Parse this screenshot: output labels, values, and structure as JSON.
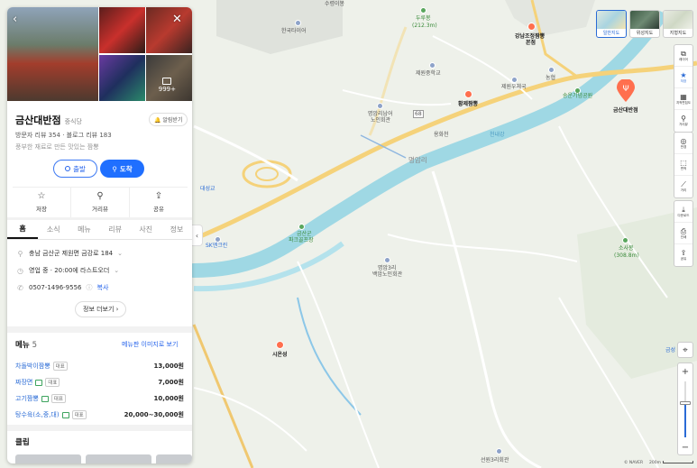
{
  "colors": {
    "accent": "#1f6fff",
    "link": "#2563eb",
    "pin": "#ff6f4e",
    "river": "#9fd8e4",
    "road_main": "#f5d27a"
  },
  "panel": {
    "photos": {
      "back_icon": "back-arrow-icon",
      "close_icon": "close-icon",
      "count": "999+"
    },
    "place": {
      "name": "금산대반점",
      "category": "중식당",
      "claim_label": "알림받기",
      "reviews": "방문자 리뷰 354 · 블로그 리뷰 183",
      "description": "풍부한 재료로 만든 맛있는 짬뽕"
    },
    "directions": {
      "start_label": "출발",
      "end_label": "도착"
    },
    "actions": [
      {
        "label": "저장",
        "icon": "star-outline-icon",
        "sym": "☆"
      },
      {
        "label": "거리뷰",
        "icon": "location-pin-icon",
        "sym": "⚲"
      },
      {
        "label": "공유",
        "icon": "share-icon",
        "sym": "⇪"
      }
    ],
    "tabs": [
      {
        "label": "홈",
        "active": true
      },
      {
        "label": "소식"
      },
      {
        "label": "메뉴"
      },
      {
        "label": "리뷰"
      },
      {
        "label": "사진"
      },
      {
        "label": "정보"
      }
    ],
    "details": {
      "address": "충남 금산군 제원면 금강로 184",
      "hours": "영업 중 · 20:00에 라스트오더",
      "phone": "0507-1496-9556",
      "copy_label": "복사",
      "more_label": "정보 더보기"
    },
    "menu": {
      "title": "메뉴",
      "count": "5",
      "image_link": "메뉴판 이미지로 보기",
      "items": [
        {
          "name": "차돌박이짬뽕",
          "badge": "대표",
          "photo": false,
          "price": "13,000원"
        },
        {
          "name": "짜장면",
          "badge": "대표",
          "photo": true,
          "price": "7,000원"
        },
        {
          "name": "고기짬뽕",
          "badge": "대표",
          "photo": true,
          "price": "10,000원"
        },
        {
          "name": "탕수육(소,중,대)",
          "badge": "대표",
          "photo": true,
          "price": "20,000~30,000원"
        }
      ]
    },
    "clip": {
      "title": "클립"
    }
  },
  "map": {
    "labels": {
      "top_mountain": "수령이봉",
      "hanjeonraeo": "한국타이어",
      "durubong": "두루봉",
      "durubong_h": "(212.3m)",
      "gangnam": "강남조정짬뽕",
      "gangnam2": "본점",
      "jewon_school": "제원중학교",
      "jewon_office": "제원우체국",
      "nonghyup": "농협",
      "songwon": "송운기념공원",
      "geumsan_pin": "금산대반점",
      "hwangje": "황제짬뽕",
      "myeongam_hall": "명암리남어",
      "myeongam_hall2": "노인회관",
      "route68": "68",
      "ryongjeon": "용화천",
      "cheonnae": "천내강",
      "myeongamri": "명암리",
      "daeseong": "대성교",
      "park": "금산군",
      "park2": "파크골프장",
      "sk": "SK엔크린",
      "myeongam3": "명암3리",
      "myeongam3b": "백암노인회관",
      "sosabong": "소사봉",
      "sosabong_h": "(308.8m)",
      "sieonseong": "시온성",
      "geumseong": "금성",
      "seonwon": "선원3리회관"
    },
    "map_types": [
      {
        "label": "일반지도",
        "active": true
      },
      {
        "label": "위성지도"
      },
      {
        "label": "지형지도"
      }
    ],
    "tools_top": [
      {
        "label": "레이어",
        "icon": "layers-icon",
        "sym": "⧉"
      },
      {
        "label": "저장",
        "icon": "star-icon",
        "sym": "★",
        "blue": true
      },
      {
        "label": "지적편집도",
        "icon": "cadastral-icon",
        "sym": "▦"
      },
      {
        "label": "거리뷰",
        "icon": "street-view-icon",
        "sym": "⚲"
      }
    ],
    "tools_mid": [
      {
        "label": "반경",
        "icon": "radius-icon",
        "sym": "◎"
      },
      {
        "label": "면적",
        "icon": "area-icon",
        "sym": "⬚"
      },
      {
        "label": "거리",
        "icon": "ruler-icon",
        "sym": "⟋"
      }
    ],
    "tools_bottom": [
      {
        "label": "다운로드",
        "icon": "download-icon",
        "sym": "⤓"
      },
      {
        "label": "인쇄",
        "icon": "print-icon",
        "sym": "⎙"
      },
      {
        "label": "공유",
        "icon": "share-icon",
        "sym": "⇪"
      }
    ],
    "zoom": {
      "plus": "+",
      "minus": "−",
      "level_fraction": 0.62
    },
    "attribution": "© NAVER",
    "scale": "200m"
  }
}
